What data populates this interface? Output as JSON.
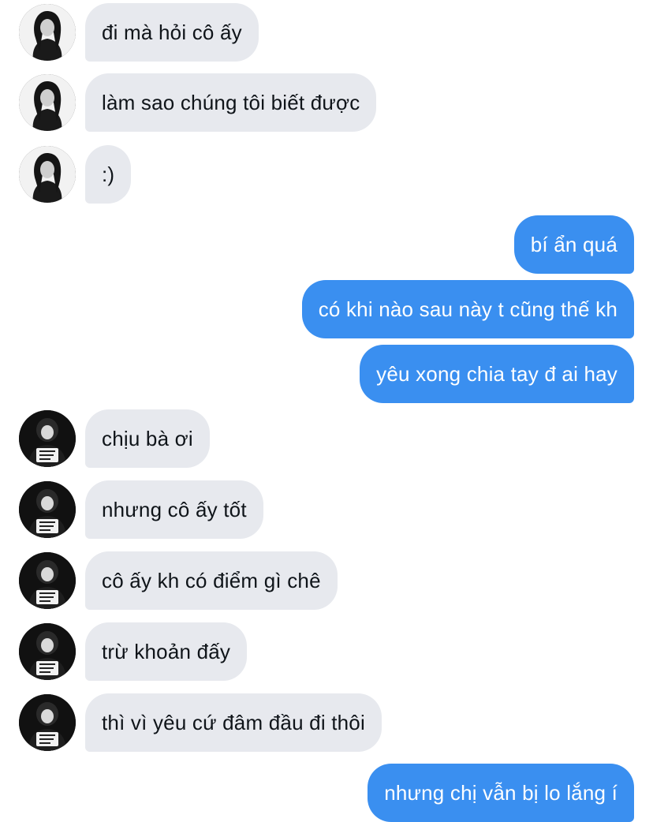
{
  "conversation": {
    "messages": [
      {
        "sender": "contact",
        "text": "đi mà hỏi cô ấy"
      },
      {
        "sender": "contact",
        "text": "làm sao chúng tôi biết được"
      },
      {
        "sender": "contact",
        "text": ":)"
      },
      {
        "sender": "me",
        "text": "bí ẩn quá"
      },
      {
        "sender": "me",
        "text": "có khi nào sau này t cũng thế kh"
      },
      {
        "sender": "me",
        "text": "yêu xong chia tay đ ai hay"
      },
      {
        "sender": "contact",
        "text": "chịu bà ơi"
      },
      {
        "sender": "contact",
        "text": "nhưng cô ấy tốt"
      },
      {
        "sender": "contact",
        "text": "cô ấy kh có điểm gì chê"
      },
      {
        "sender": "contact",
        "text": "trừ khoản đấy"
      },
      {
        "sender": "contact",
        "text": "thì vì yêu cứ đâm đầu đi thôi"
      },
      {
        "sender": "me",
        "text": "nhưng chị vẫn bị lo lắng í"
      }
    ]
  },
  "colors": {
    "incoming_bubble": "#e7e9ee",
    "outgoing_bubble": "#3a8ff0",
    "incoming_text": "#0f1419",
    "outgoing_text": "#ffffff"
  },
  "icons": {
    "contact_avatar_a": "profile-photo-girl-long-hair",
    "contact_avatar_b": "profile-photo-girl-holding-bag"
  }
}
